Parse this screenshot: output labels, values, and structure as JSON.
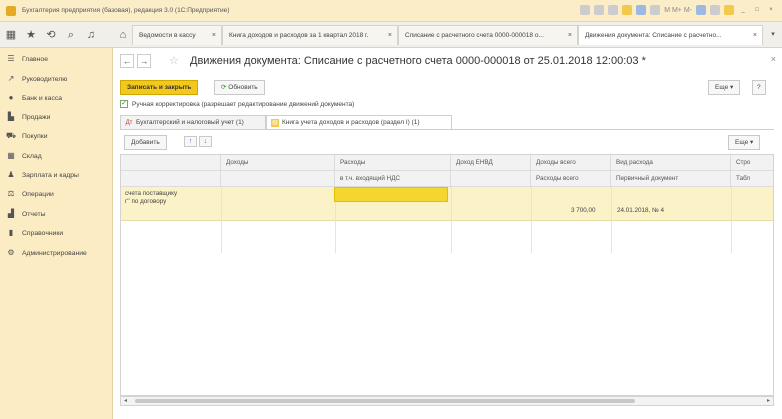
{
  "app": {
    "title": "Бухгалтерия предприятия (базовая), редакция 3.0 (1С:Предприятие)",
    "toolbar_text": "M M+ M-"
  },
  "tabs": [
    {
      "label": "Ведомости в кассу"
    },
    {
      "label": "Книга доходов и расходов за 1 квартал 2018 г."
    },
    {
      "label": "Списание с расчетного счета 0000-000018 о..."
    },
    {
      "label": "Движения документа: Списание с расчетно..."
    }
  ],
  "sidebar": {
    "items": [
      {
        "label": "Главное",
        "icon": "menu-icon"
      },
      {
        "label": "Руководителю",
        "icon": "chart-line-icon"
      },
      {
        "label": "Банк и касса",
        "icon": "bank-icon"
      },
      {
        "label": "Продажи",
        "icon": "sales-icon"
      },
      {
        "label": "Покупки",
        "icon": "cart-icon"
      },
      {
        "label": "Склад",
        "icon": "warehouse-icon"
      },
      {
        "label": "Зарплата и кадры",
        "icon": "person-icon"
      },
      {
        "label": "Операции",
        "icon": "operations-icon"
      },
      {
        "label": "Отчеты",
        "icon": "reports-icon"
      },
      {
        "label": "Справочники",
        "icon": "book-icon"
      },
      {
        "label": "Администрирование",
        "icon": "gear-icon"
      }
    ]
  },
  "doc": {
    "title": "Движения документа: Списание с расчетного счета 0000-000018 от 25.01.2018 12:00:03 *",
    "save_close_label": "Записать и закрыть",
    "refresh_label": "Обновить",
    "more_label": "Еще",
    "help_label": "?",
    "manual_edit_label": "Ручная корректировка (разрешает редактирование движений документа)",
    "manual_edit_checked": true
  },
  "subtabs": [
    {
      "label": "Бухгалтерский и налоговый учет (1)"
    },
    {
      "label": "Книга учета доходов и расходов (раздел I) (1)"
    }
  ],
  "table": {
    "add_label": "Добавить",
    "more_label": "Еще",
    "headers_row1": [
      "",
      "Доходы",
      "Расходы",
      "Доход ЕНВД",
      "Доходы всего",
      "Вид расхода",
      "Стро"
    ],
    "headers_row2": [
      "",
      "",
      "в т.ч. входящий НДС",
      "",
      "Расходы всего",
      "Первичный документ",
      "Табл"
    ],
    "row": {
      "desc_line1": "счета поставщику",
      "desc_line2": "г'' по договору",
      "amount": "3 700,00",
      "document": "24.01.2018, № 4"
    }
  }
}
